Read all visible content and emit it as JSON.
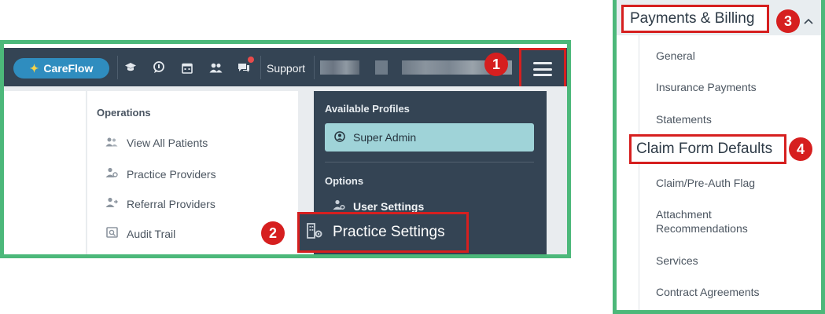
{
  "topbar": {
    "brand": "CareFlow",
    "support": "Support",
    "icons": [
      "graduation-cap-icon",
      "lightbulb-chat-icon",
      "calendar-icon",
      "users-icon",
      "chat-icon",
      "menu-icon"
    ]
  },
  "operations": {
    "title": "Operations",
    "items": [
      {
        "label": "View All Patients",
        "icon": "users-icon"
      },
      {
        "label": "Practice Providers",
        "icon": "provider-icon"
      },
      {
        "label": "Referral Providers",
        "icon": "referral-icon"
      },
      {
        "label": "Audit Trail",
        "icon": "audit-icon"
      }
    ]
  },
  "profiles": {
    "title": "Available Profiles",
    "selected": "Super Admin",
    "options_title": "Options",
    "user_settings": "User Settings",
    "practice_settings": "Practice Settings"
  },
  "billing_menu": {
    "header": "Payments & Billing",
    "items": [
      "General",
      "Insurance Payments",
      "Statements",
      "Claim Form Defaults",
      "Claim/Pre-Auth Flag",
      "Attachment Recommendations",
      "Services",
      "Contract Agreements"
    ]
  },
  "steps": [
    "1",
    "2",
    "3",
    "4"
  ],
  "colors": {
    "frame_green": "#4cb87a",
    "highlight_red": "#d61f1f",
    "topbar": "#344454",
    "brand": "#2f8dbf",
    "selected_profile": "#9fd3d8"
  }
}
